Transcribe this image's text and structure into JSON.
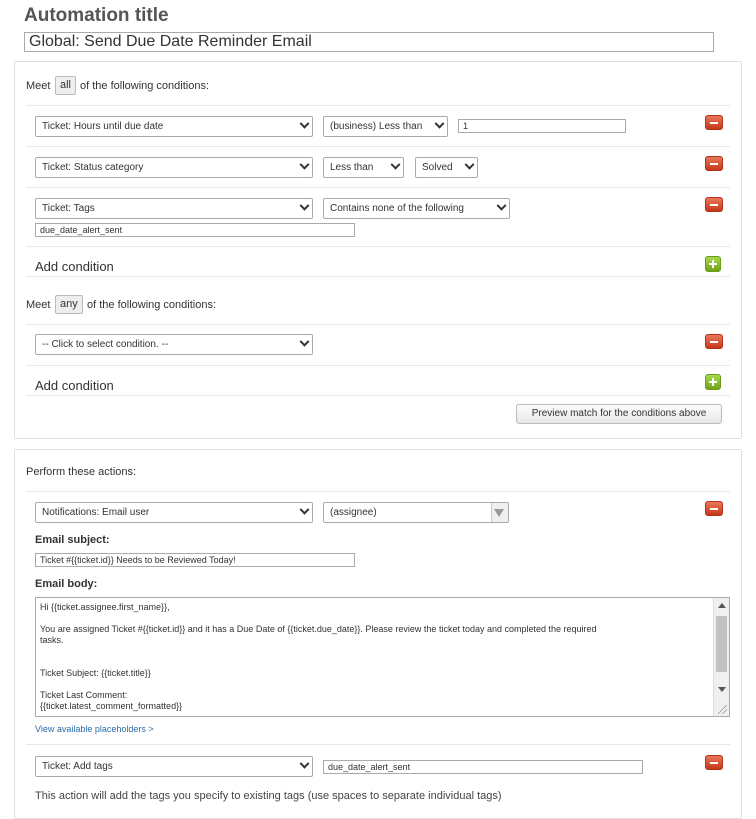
{
  "automation_title_label": "Automation title",
  "automation_title_value": "Global: Send Due Date Reminder Email",
  "all_conditions": {
    "meet_label": "Meet",
    "qualifier": "all",
    "suffix": "of the following conditions:",
    "rows": [
      {
        "field": "Ticket: Hours until due date",
        "operator": "(business) Less than",
        "value": "1"
      },
      {
        "field": "Ticket: Status category",
        "operator": "Less than",
        "value": "Solved"
      },
      {
        "field": "Ticket: Tags",
        "operator": "Contains none of the following",
        "value": "due_date_alert_sent"
      }
    ],
    "add_label": "Add condition"
  },
  "any_conditions": {
    "meet_label": "Meet",
    "qualifier": "any",
    "suffix": "of the following conditions:",
    "rows": [
      {
        "field": "-- Click to select condition. --"
      }
    ],
    "add_label": "Add condition"
  },
  "preview_button": "Preview match for the conditions above",
  "actions": {
    "heading": "Perform these actions:",
    "email_action": {
      "field": "Notifications: Email user",
      "recipient": "(assignee)",
      "subject_label": "Email subject:",
      "subject_value": "Ticket #{{ticket.id}} Needs to be Reviewed Today!",
      "body_label": "Email body:",
      "body_lines": [
        "Hi {{ticket.assignee.first_name}},",
        "",
        "You are assigned Ticket #{{ticket.id}} and it has a Due Date of {{ticket.due_date}}. Please review the ticket today and completed the required",
        "tasks.",
        "",
        "",
        "Ticket Subject: {{ticket.title}}",
        "",
        "Ticket Last Comment:",
        "{{ticket.latest_comment_formatted}}"
      ],
      "placeholders_link": "View available placeholders >"
    },
    "tags_action": {
      "field": "Ticket: Add tags",
      "value": "due_date_alert_sent",
      "note": "This action will add the tags you specify to existing tags (use spaces to separate individual tags)"
    }
  },
  "icons": {
    "remove": "minus-icon",
    "add": "plus-icon",
    "dropdown": "chevron-down-icon"
  },
  "colors": {
    "remove_button": "#d9482a",
    "add_button": "#8cc034",
    "link": "#2b6aa8"
  }
}
